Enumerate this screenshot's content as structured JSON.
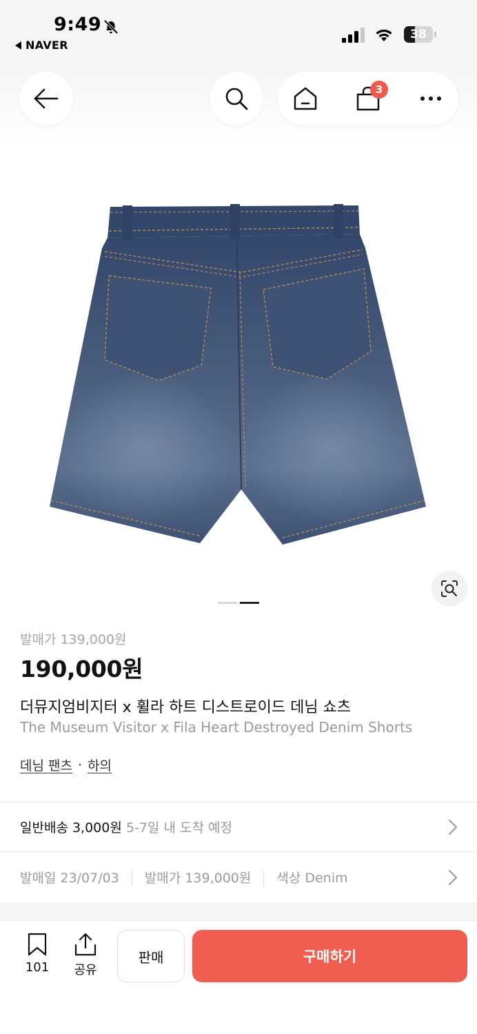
{
  "status_bar": {
    "time": "9:49",
    "back_app": "NAVER",
    "battery": "38",
    "battery_level": 0.38
  },
  "nav": {
    "cart_count": "3"
  },
  "product": {
    "image_alt": "denim-shorts-back-view",
    "image_count": 2,
    "active_image": 2,
    "release_price": "발매가 139,000원",
    "price": "190,000원",
    "title_ko": "더뮤지엄비지터 x 휠라 하트 디스트로이드 데님 쇼츠",
    "title_en": "The Museum Visitor x Fila Heart Destroyed Denim Shorts",
    "categories": [
      "데님 팬츠",
      "하의"
    ],
    "category_separator": "·"
  },
  "delivery": {
    "label": "일반배송 3,000원",
    "eta": "5-7일 내 도착 예정"
  },
  "meta": {
    "release_date": "발매일 23/07/03",
    "release_price": "발매가 139,000원",
    "color": "색상 Denim"
  },
  "bottom_bar": {
    "bookmark_count": "101",
    "share_label": "공유",
    "sell_label": "판매",
    "buy_label": "구매하기"
  },
  "colors": {
    "accent": "#ef5e50",
    "badge": "#ef5a4f",
    "muted_text": "#9a9a9a",
    "denim": "#3e5170"
  },
  "icons": [
    "bell-off-icon",
    "signal-icon",
    "wifi-icon",
    "battery-icon",
    "back-arrow-icon",
    "search-icon",
    "home-icon",
    "cart-icon",
    "more-icon",
    "lens-icon",
    "chevron-right-icon",
    "bookmark-icon",
    "share-icon"
  ]
}
